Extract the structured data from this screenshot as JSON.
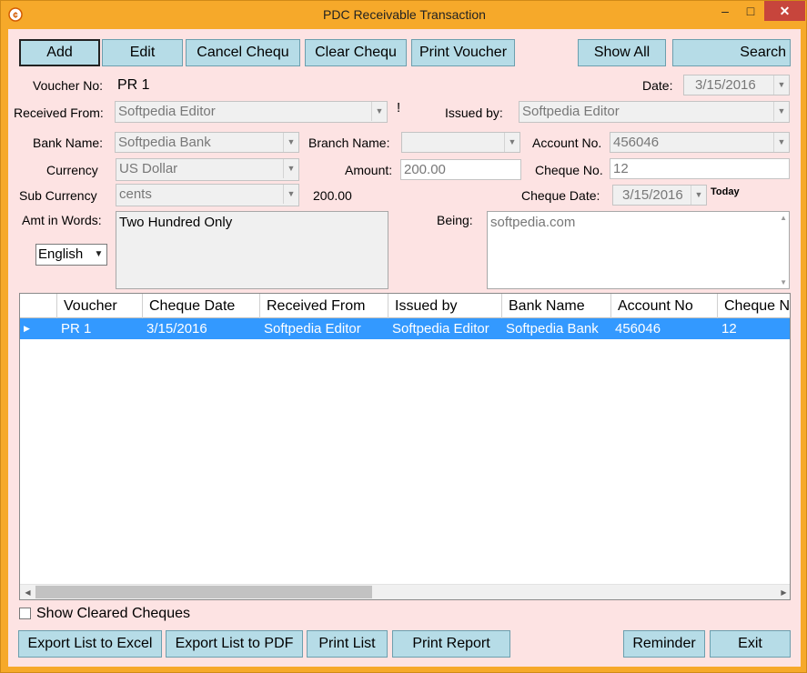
{
  "window": {
    "title": "PDC Receivable Transaction",
    "minimize": "–",
    "maximize": "□",
    "close": "✕"
  },
  "toolbar": {
    "add": "Add",
    "edit": "Edit",
    "cancel_cheque": "Cancel Chequ",
    "clear_cheque": "Clear Chequ",
    "print_voucher": "Print Voucher",
    "show_all": "Show All",
    "search": "Search"
  },
  "form": {
    "voucher_no_label": "Voucher No:",
    "voucher_no_value": "PR 1",
    "date_label": "Date:",
    "date_value": "3/15/2016",
    "received_from_label": "Received From:",
    "received_from_value": "Softpedia Editor",
    "exclaim": "!",
    "issued_by_label": "Issued by:",
    "issued_by_value": "Softpedia Editor",
    "bank_name_label": "Bank Name:",
    "bank_name_value": "Softpedia Bank",
    "branch_name_label": "Branch Name:",
    "branch_name_value": "",
    "account_no_label": "Account No.",
    "account_no_value": "456046",
    "currency_label": "Currency",
    "currency_value": "US Dollar",
    "amount_label": "Amount:",
    "amount_value": "200.00",
    "cheque_no_label": "Cheque No.",
    "cheque_no_value": "12",
    "sub_currency_label": "Sub Currency",
    "sub_currency_value": "cents",
    "sub_amount_value": "200.00",
    "cheque_date_label": "Cheque Date:",
    "cheque_date_value": "3/15/2016",
    "today_label": "Today",
    "amt_in_words_label": "Amt in Words:",
    "amt_in_words_value": "Two Hundred Only",
    "language_value": "English",
    "being_label": "Being:",
    "being_value": "softpedia.com"
  },
  "grid": {
    "columns": [
      "Voucher",
      "Cheque Date",
      "Received From",
      "Issued by",
      "Bank Name",
      "Account No",
      "Cheque No"
    ],
    "rows": [
      [
        "PR 1",
        "3/15/2016",
        "Softpedia Editor",
        "Softpedia Editor",
        "Softpedia Bank",
        "456046",
        "12"
      ]
    ]
  },
  "footer": {
    "show_cleared": "Show Cleared Cheques",
    "export_excel": "Export List to Excel",
    "export_pdf": "Export List to PDF",
    "print_list": "Print List",
    "print_report": "Print Report",
    "reminder": "Reminder",
    "exit": "Exit"
  },
  "colors": {
    "frame": "#f6a92a",
    "client_bg": "#fde3e3",
    "button_bg": "#b6dce7",
    "selected_row": "#3399ff"
  }
}
